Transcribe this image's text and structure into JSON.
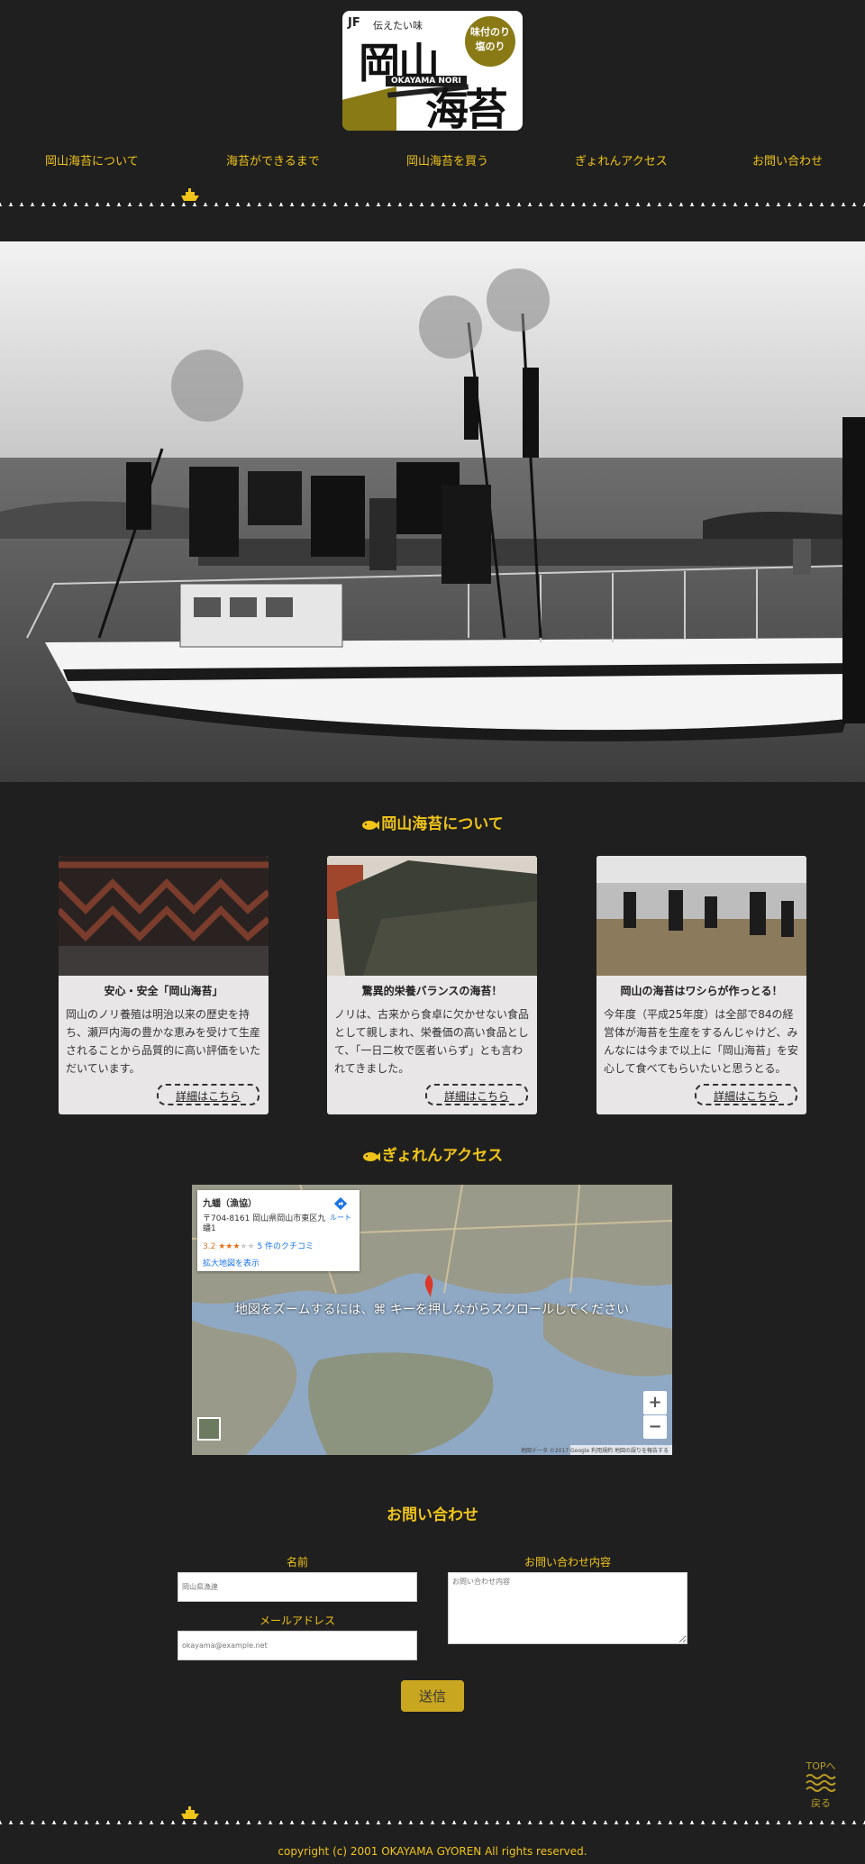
{
  "logo": {
    "jf": "JF",
    "tagline": "伝えたい味",
    "title": "岡山",
    "title2": "海苔",
    "roman": "OKAYAMA NORI",
    "badge_line1": "味付のり",
    "badge_line2": "塩のり"
  },
  "nav": {
    "items": [
      {
        "label": "岡山海苔について"
      },
      {
        "label": "海苔ができるまで"
      },
      {
        "label": "岡山海苔を買う"
      },
      {
        "label": "ぎょれんアクセス"
      },
      {
        "label": "お問い合わせ"
      }
    ]
  },
  "about": {
    "heading": "岡山海苔について",
    "cards": [
      {
        "title": "安心・安全「岡山海苔」",
        "text": "岡山のノリ養殖は明治以来の歴史を持ち、瀬戸内海の豊かな恵みを受けて生産されることから品質的に高い評価をいただいています。",
        "link": "詳細はこちら"
      },
      {
        "title": "驚異的栄養バランスの海苔！",
        "text": "ノリは、古来から食卓に欠かせない食品として親しまれ、栄養価の高い食品として、「一日二枚で医者いらず」とも言われてきました。",
        "link": "詳細はこちら"
      },
      {
        "title": "岡山の海苔はワシらが作っとる！",
        "text": "今年度（平成25年度）は全部で84の経営体が海苔を生産をするんじゃけど、みんなには今まで以上に「岡山海苔」を安心して食べてもらいたいと思うとる。",
        "link": "詳細はこちら"
      }
    ]
  },
  "access": {
    "heading": "ぎょれんアクセス",
    "map": {
      "place_name": "九蟠（漁協）",
      "address": "〒704-8161 岡山県岡山市東区九蟠1",
      "rating": "3.2",
      "reviews": "5 件のクチコミ",
      "larger_map": "拡大地図を表示",
      "route": "ルート",
      "overlay_text": "地図をズームするには、⌘ キーを押しながらスクロールしてください",
      "zoom_in": "+",
      "zoom_out": "−",
      "attribution": "地図データ ©2017 Google 利用規約 地図の誤りを報告する"
    }
  },
  "contact": {
    "heading": "お問い合わせ",
    "name_label": "名前",
    "name_placeholder": "岡山県漁連",
    "email_label": "メールアドレス",
    "email_placeholder": "okayama@example.net",
    "message_label": "お問い合わせ内容",
    "message_placeholder": "お問い合わせ内容",
    "submit": "送信"
  },
  "totop": {
    "line1": "TOPへ",
    "line2": "戻る"
  },
  "footer": {
    "copyright": "copyright (c) 2001 OKAYAMA GYOREN All rights reserved."
  },
  "colors": {
    "background": "#1f1f1f",
    "accent": "#f0c419",
    "card": "#e8e6e6",
    "button": "#c9a620"
  }
}
